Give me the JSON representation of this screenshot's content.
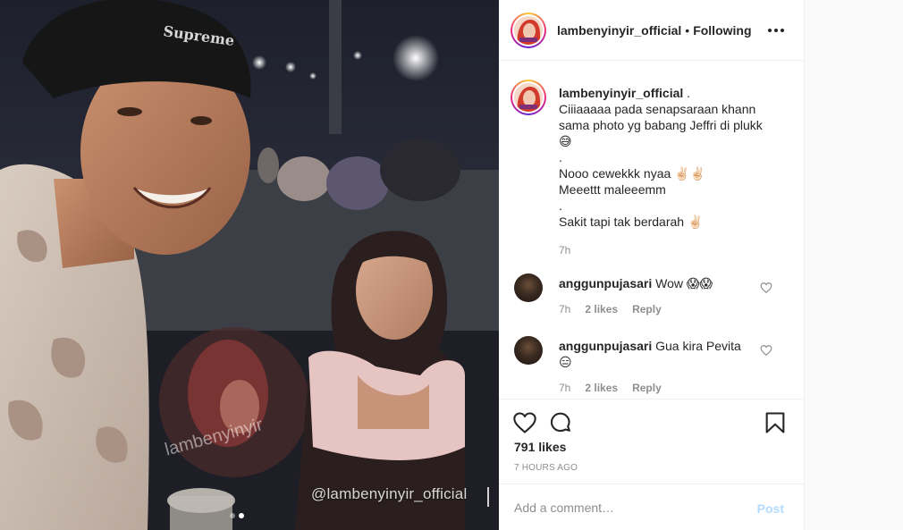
{
  "media": {
    "watermark": "@lambenyinyir_official",
    "beanie_text": "Supreme",
    "logo_text": "lambenyinyir",
    "carousel": {
      "count": 2,
      "active": 1
    }
  },
  "header": {
    "username": "lambenyinyir_official",
    "separator": "•",
    "follow_status": "Following",
    "more_icon": "more-horizontal-icon"
  },
  "caption": {
    "username": "lambenyinyir_official",
    "username_suffix": " .",
    "lines": [
      "Ciiiaaaaa pada senapsaraan khann",
      "sama photo yg babang Jeffri di plukk",
      "😅",
      ".",
      "Nooo cewekkk nyaa ✌🏻✌🏻",
      "Meeettt maleeemm",
      ".",
      "Sakit tapi tak berdarah ✌🏻"
    ],
    "time": "7h"
  },
  "comments": [
    {
      "username": "anggunpujasari",
      "text": "Wow 😱😱",
      "time": "7h",
      "likes": "2 likes",
      "reply": "Reply"
    },
    {
      "username": "anggunpujasari",
      "text": "Gua kira Pevita",
      "text2": "😑",
      "time": "7h",
      "likes": "2 likes",
      "reply": "Reply"
    }
  ],
  "actions": {
    "like_icon": "heart-icon",
    "comment_icon": "comment-icon",
    "save_icon": "bookmark-icon",
    "likes_count": "791 likes",
    "posted_ago": "7 HOURS AGO"
  },
  "add_comment": {
    "placeholder": "Add a comment…",
    "post_label": "Post"
  },
  "colors": {
    "text": "#262626",
    "muted": "#8e8e8e",
    "border": "#efefef",
    "post_disabled": "#b3dbff"
  }
}
